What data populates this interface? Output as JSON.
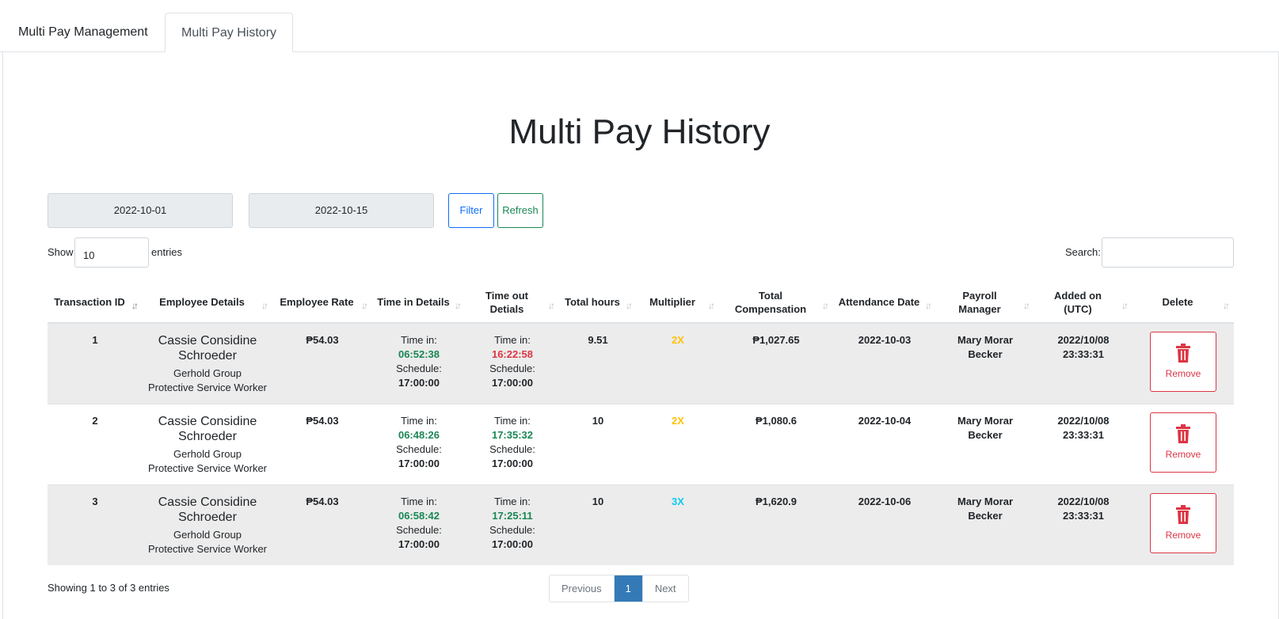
{
  "tabs": [
    {
      "label": "Multi Pay Management"
    },
    {
      "label": "Multi Pay History"
    }
  ],
  "page_title": "Multi Pay History",
  "filters": {
    "start_date": "2022-10-01",
    "end_date": "2022-10-15",
    "filter_label": "Filter",
    "refresh_label": "Refresh"
  },
  "length": {
    "show_label": "Show",
    "value": "10",
    "entries_label": "entries"
  },
  "search": {
    "label": "Search:",
    "value": ""
  },
  "columns": [
    "Transaction ID",
    "Employee Details",
    "Employee Rate",
    "Time in Details",
    "Time out Detials",
    "Total hours",
    "Multiplier",
    "Total Compensation",
    "Attendance Date",
    "Payroll Manager",
    "Added on (UTC)",
    "Delete"
  ],
  "rows": [
    {
      "id": "1",
      "name": "Cassie Considine Schroeder",
      "company": "Gerhold Group",
      "position": "Protective Service Worker",
      "rate": "₱54.03",
      "time_in_label": "Time in:",
      "time_in": "06:52:38",
      "in_sched_label": "Schedule:",
      "in_sched": "17:00:00",
      "time_out_label": "Time in:",
      "time_out": "16:22:58",
      "out_sched_label": "Schedule:",
      "out_sched": "17:00:00",
      "hours": "9.51",
      "multiplier": "2X",
      "compensation": "₱1,027.65",
      "date": "2022-10-03",
      "manager": "Mary Morar Becker",
      "added": "2022/10/08 23:33:31",
      "remove_label": "Remove"
    },
    {
      "id": "2",
      "name": "Cassie Considine Schroeder",
      "company": "Gerhold Group",
      "position": "Protective Service Worker",
      "rate": "₱54.03",
      "time_in_label": "Time in:",
      "time_in": "06:48:26",
      "in_sched_label": "Schedule:",
      "in_sched": "17:00:00",
      "time_out_label": "Time in:",
      "time_out": "17:35:32",
      "out_sched_label": "Schedule:",
      "out_sched": "17:00:00",
      "hours": "10",
      "multiplier": "2X",
      "compensation": "₱1,080.6",
      "date": "2022-10-04",
      "manager": "Mary Morar Becker",
      "added": "2022/10/08 23:33:31",
      "remove_label": "Remove"
    },
    {
      "id": "3",
      "name": "Cassie Considine Schroeder",
      "company": "Gerhold Group",
      "position": "Protective Service Worker",
      "rate": "₱54.03",
      "time_in_label": "Time in:",
      "time_in": "06:58:42",
      "in_sched_label": "Schedule:",
      "in_sched": "17:00:00",
      "time_out_label": "Time in:",
      "time_out": "17:25:11",
      "out_sched_label": "Schedule:",
      "out_sched": "17:00:00",
      "hours": "10",
      "multiplier": "3X",
      "compensation": "₱1,620.9",
      "date": "2022-10-06",
      "manager": "Mary Morar Becker",
      "added": "2022/10/08 23:33:31",
      "remove_label": "Remove"
    }
  ],
  "info": "Showing 1 to 3 of 3 entries",
  "pagination": {
    "previous": "Previous",
    "current": "1",
    "next": "Next"
  },
  "colors": {
    "late_out": "#dc3545",
    "on_time": "#198754",
    "mult_2x": "#ffc107",
    "mult_3x": "#0dcaf0",
    "danger": "#dc3545",
    "page_active": "#337ab7"
  }
}
